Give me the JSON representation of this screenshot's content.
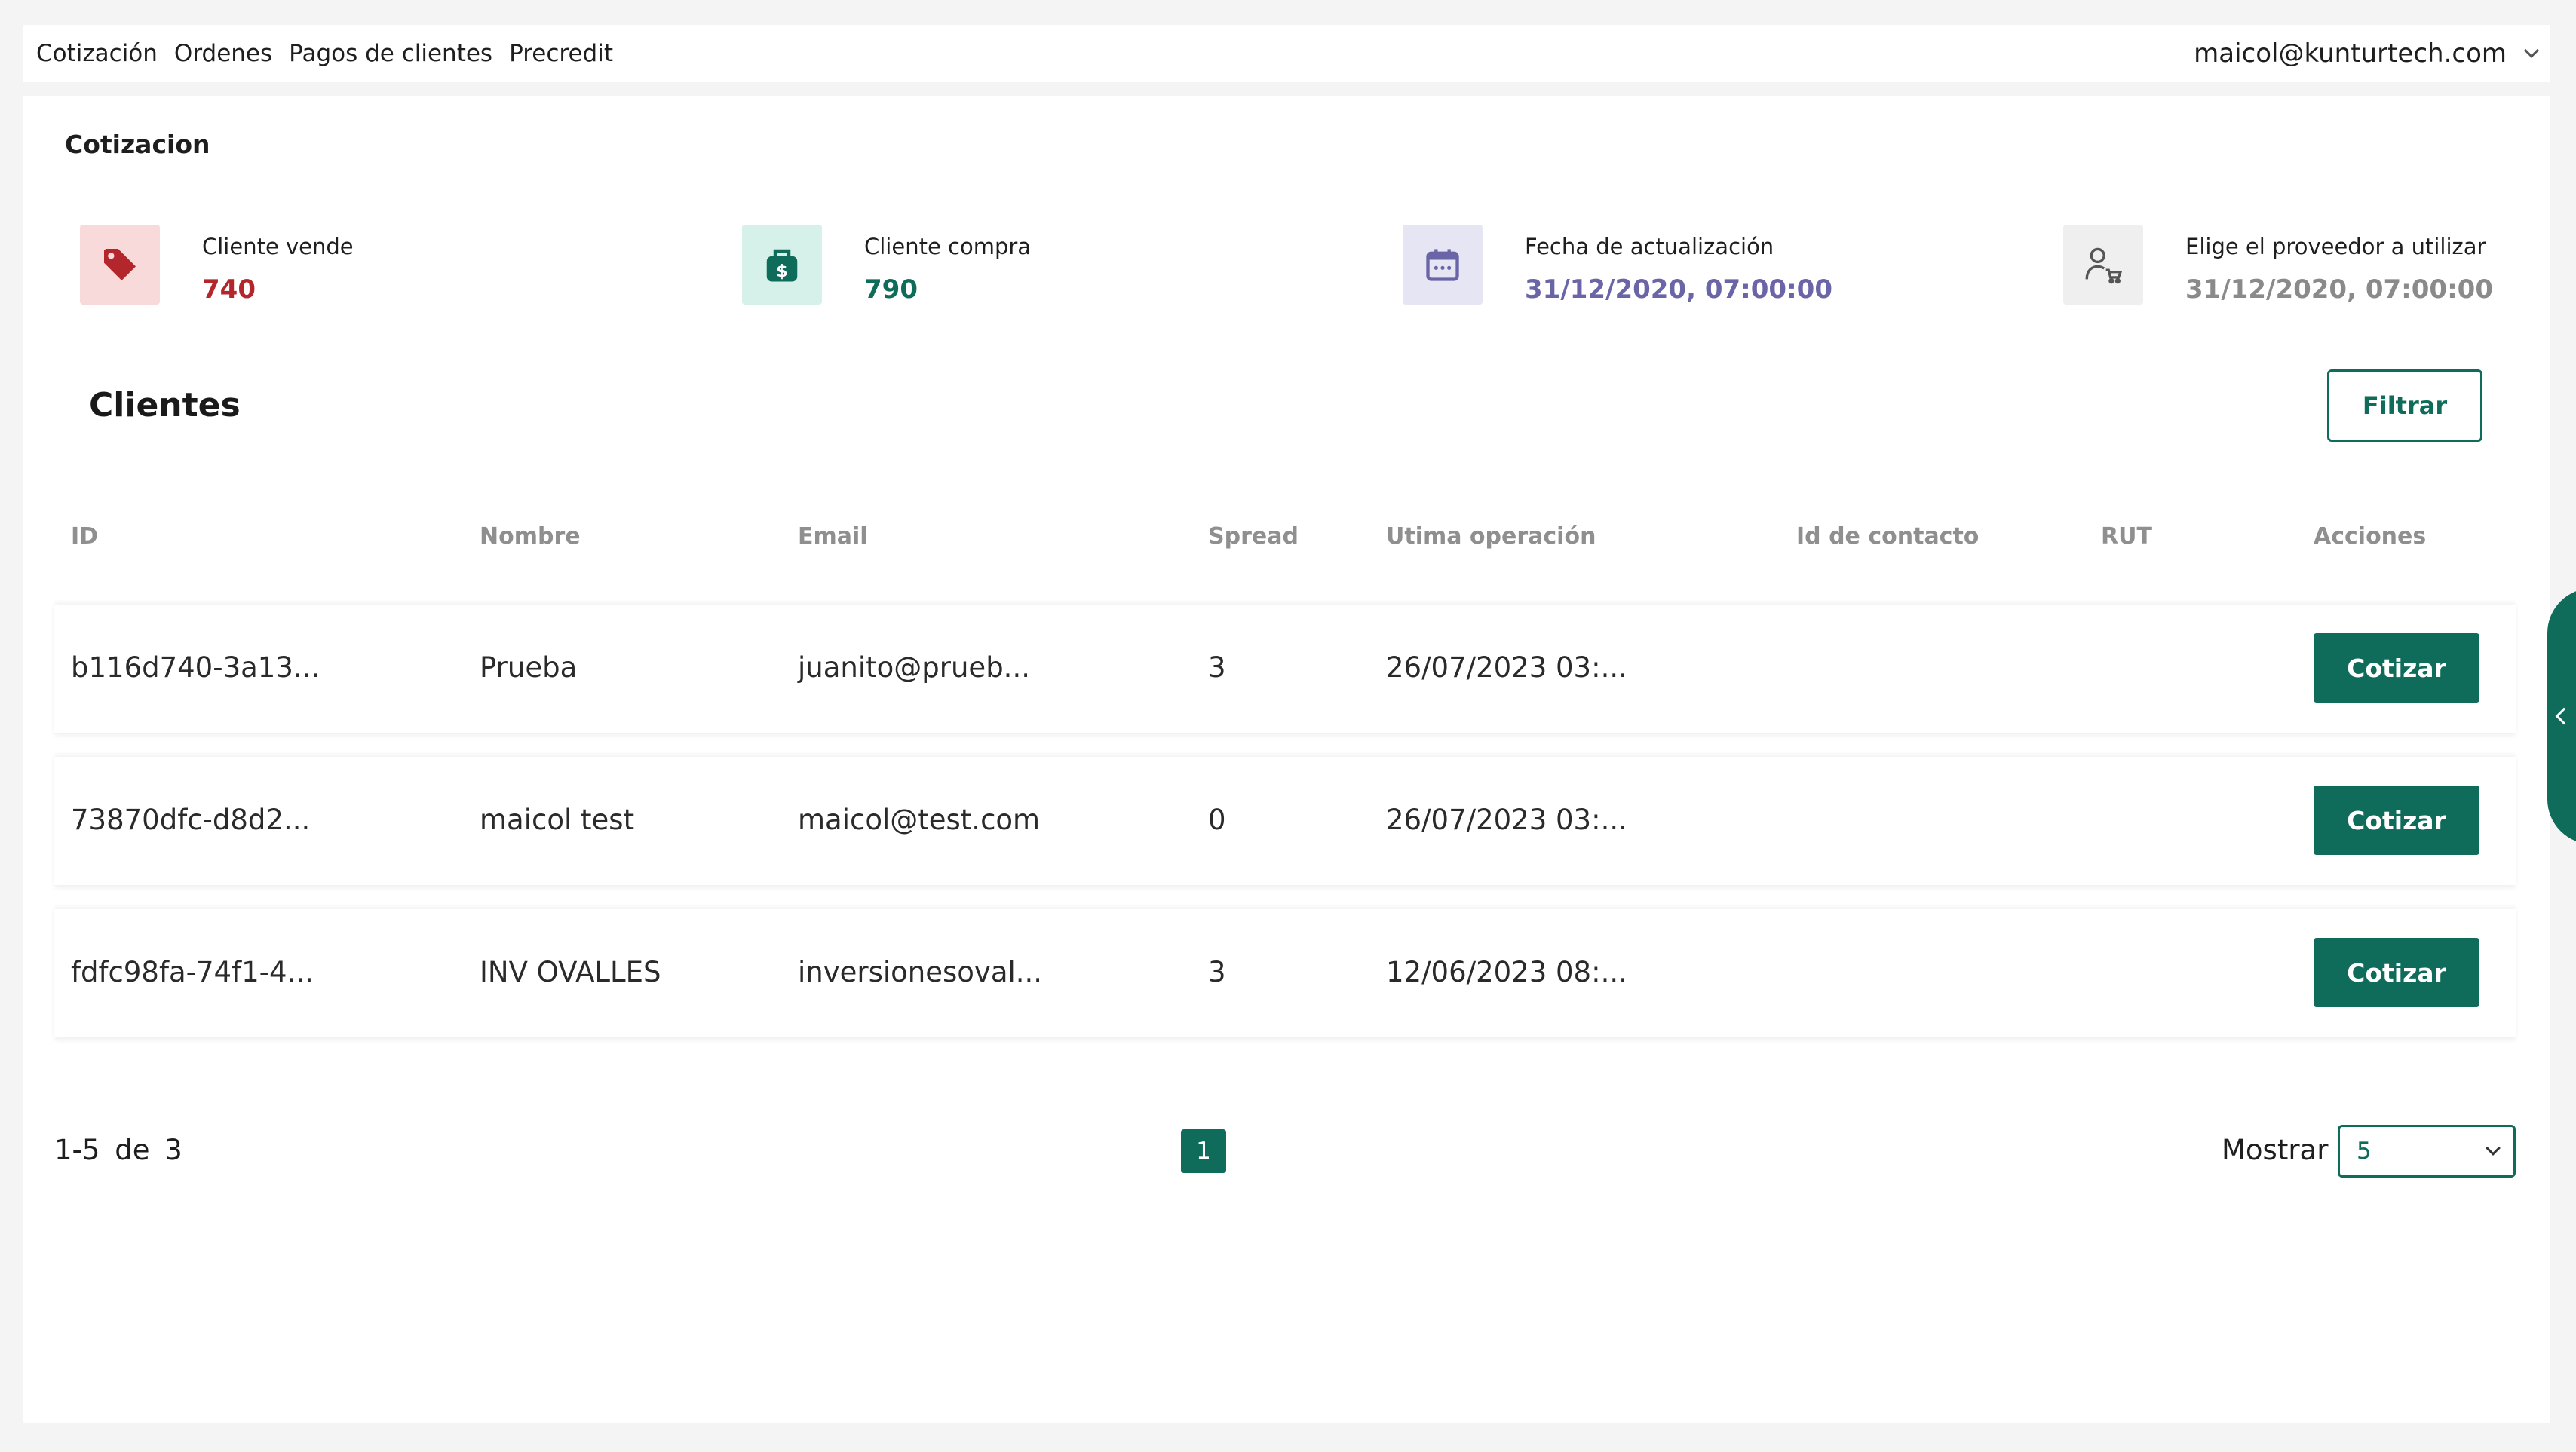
{
  "nav": {
    "items": [
      "Cotización",
      "Ordenes",
      "Pagos de clientes",
      "Precredit"
    ],
    "user_email": "maicol@kunturtech.com"
  },
  "section_title": "Cotizacion",
  "stats": [
    {
      "label": "Cliente vende",
      "value": "740",
      "icon": "tag-icon",
      "color": "#b3262c",
      "bg": "#f9dadb"
    },
    {
      "label": "Cliente compra",
      "value": "790",
      "icon": "money-bag-icon",
      "color": "#0f6b5a",
      "bg": "#d6f1ea"
    },
    {
      "label": "Fecha de actualización",
      "value": "31/12/2020, 07:00:00",
      "icon": "calendar-icon",
      "color": "#6a65a6",
      "bg": "#e6e5f3"
    },
    {
      "label": "Elige el proveedor a utilizar",
      "value": "31/12/2020, 07:00:00",
      "icon": "user-cart-icon",
      "color": "#8a8a8a",
      "bg": "#efefef"
    }
  ],
  "clients": {
    "title": "Clientes",
    "filter_label": "Filtrar",
    "columns": [
      "ID",
      "Nombre",
      "Email",
      "Spread",
      "Utima operación",
      "Id de contacto",
      "RUT",
      "Acciones"
    ],
    "rows": [
      {
        "id": "b116d740-3a13...",
        "nombre": "Prueba",
        "email": "juanito@prueb...",
        "spread": "3",
        "ultima": "26/07/2023 03:...",
        "contacto": "",
        "rut": "",
        "action": "Cotizar"
      },
      {
        "id": "73870dfc-d8d2...",
        "nombre": "maicol test",
        "email": "maicol@test.com",
        "spread": "0",
        "ultima": "26/07/2023 03:...",
        "contacto": "",
        "rut": "",
        "action": "Cotizar"
      },
      {
        "id": "fdfc98fa-74f1-4...",
        "nombre": "INV OVALLES",
        "email": "inversionesoval...",
        "spread": "3",
        "ultima": "12/06/2023 08:...",
        "contacto": "",
        "rut": "",
        "action": "Cotizar"
      }
    ]
  },
  "pagination": {
    "range": "1-5",
    "of_label": "de",
    "total": "3",
    "current_page": "1",
    "show_label": "Mostrar",
    "page_size": "5"
  },
  "colors": {
    "accent": "#0f6b5a"
  }
}
